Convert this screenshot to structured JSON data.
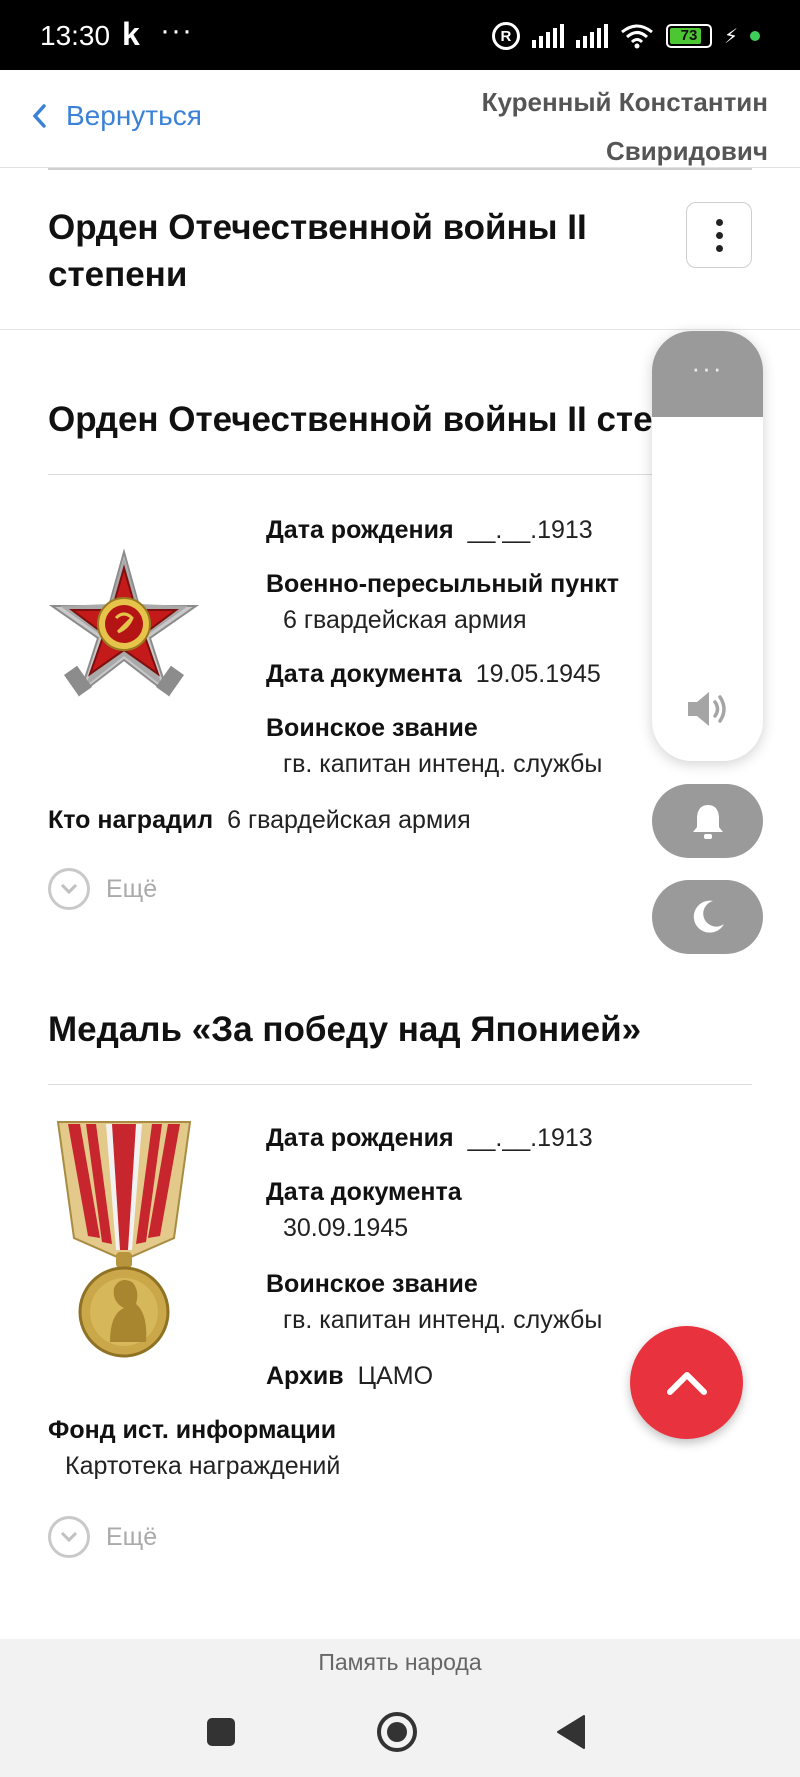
{
  "status_bar": {
    "time": "13:30",
    "app_glyph": "k",
    "more": "···",
    "registered_glyph": "R",
    "battery_level": "73",
    "colors": {
      "battery": "#4cc733",
      "dot": "#3ccf5a"
    }
  },
  "header": {
    "back_label": "Вернуться",
    "person_name_line1": "Куренный Константин",
    "person_name_line2": "Свиридович"
  },
  "title_bar": {
    "title": "Орден Отечественной войны II степени"
  },
  "awards": [
    {
      "title": "Орден Отечественной войны II степени",
      "icon": "order-patriotic-war-icon",
      "fields": [
        {
          "label": "Дата рождения",
          "value": "__.__.1913"
        },
        {
          "label": "Военно-пересыльный пункт",
          "value": "6 гвардейская армия"
        },
        {
          "label": "Дата документа",
          "value": "19.05.1945"
        },
        {
          "label": "Воинское звание",
          "value": "гв. капитан интенд. службы"
        },
        {
          "label": "Кто наградил",
          "value": "6 гвардейская армия"
        }
      ],
      "more_label": "Ещё"
    },
    {
      "title": "Медаль «За победу над Японией»",
      "icon": "medal-victory-over-japan-icon",
      "fields": [
        {
          "label": "Дата рождения",
          "value": "__.__.1913"
        },
        {
          "label": "Дата документа",
          "value": "30.09.1945"
        },
        {
          "label": "Воинское звание",
          "value": "гв. капитан интенд. службы"
        },
        {
          "label": "Архив",
          "value": "ЦАМО"
        },
        {
          "label": "Фонд ист. информации",
          "value": "Картотека награждений"
        }
      ],
      "more_label": "Ещё"
    }
  ],
  "volume_overlay": {
    "dots": "···",
    "level": 0,
    "icons": [
      "speaker-icon",
      "bell-icon",
      "moon-icon"
    ]
  },
  "fab": {
    "icon": "chevron-up-icon",
    "color": "#e8333f"
  },
  "footer": {
    "label": "Память народа"
  },
  "nav_bar": {
    "icons": [
      "recents-square-icon",
      "home-circle-icon",
      "back-triangle-icon"
    ]
  },
  "colors": {
    "link": "#3b82d6"
  }
}
